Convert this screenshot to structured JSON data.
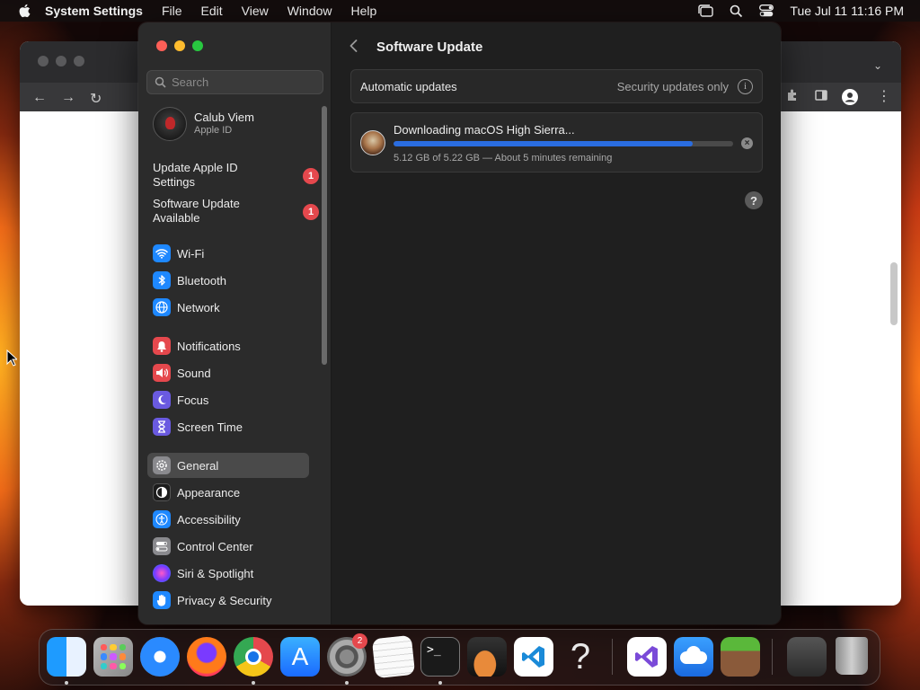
{
  "menubar": {
    "app_name": "System Settings",
    "items": [
      "File",
      "Edit",
      "View",
      "Window",
      "Help"
    ],
    "datetime": "Tue Jul 11  11:16 PM"
  },
  "sidebar": {
    "search_placeholder": "Search",
    "account": {
      "name": "Calub Viem",
      "subtitle": "Apple ID"
    },
    "notices": [
      {
        "label": "Update Apple ID Settings",
        "badge": "1"
      },
      {
        "label": "Software Update Available",
        "badge": "1"
      }
    ],
    "items": [
      {
        "label": "Wi-Fi",
        "icon": "wifi-icon",
        "color": "#1e88ff"
      },
      {
        "label": "Bluetooth",
        "icon": "bluetooth-icon",
        "color": "#1e88ff"
      },
      {
        "label": "Network",
        "icon": "globe-icon",
        "color": "#1e88ff"
      },
      {
        "label": "Notifications",
        "icon": "bell-icon",
        "color": "#e5484d"
      },
      {
        "label": "Sound",
        "icon": "speaker-icon",
        "color": "#e5484d"
      },
      {
        "label": "Focus",
        "icon": "moon-icon",
        "color": "#6a5ae0"
      },
      {
        "label": "Screen Time",
        "icon": "hourglass-icon",
        "color": "#6a5ae0"
      },
      {
        "label": "General",
        "icon": "gear-icon",
        "color": "#8a8a8e",
        "selected": true
      },
      {
        "label": "Appearance",
        "icon": "appearance-icon",
        "color": "#1c1c1c"
      },
      {
        "label": "Accessibility",
        "icon": "accessibility-icon",
        "color": "#1e88ff"
      },
      {
        "label": "Control Center",
        "icon": "toggles-icon",
        "color": "#8a8a8e"
      },
      {
        "label": "Siri & Spotlight",
        "icon": "siri-icon",
        "color": "#b04aff"
      },
      {
        "label": "Privacy & Security",
        "icon": "hand-icon",
        "color": "#1e88ff"
      }
    ]
  },
  "content": {
    "title": "Software Update",
    "automatic_updates": {
      "label": "Automatic updates",
      "value": "Security updates only"
    },
    "download": {
      "title": "Downloading macOS High Sierra...",
      "status": "5.12 GB of 5.22 GB — About 5 minutes remaining",
      "progress": 0.88
    }
  },
  "dock": {
    "settings_badge": "2",
    "apps": [
      "finder-icon",
      "launchpad-icon",
      "safari-icon",
      "firefox-icon",
      "chrome-icon",
      "app-store-icon",
      "system-settings-icon",
      "textedit-icon",
      "terminal-icon",
      "garageband-icon",
      "vscode-icon",
      "help-icon",
      "visual-studio-icon",
      "weather-icon",
      "minecraft-icon",
      "downloads-stack-icon",
      "trash-icon"
    ]
  }
}
